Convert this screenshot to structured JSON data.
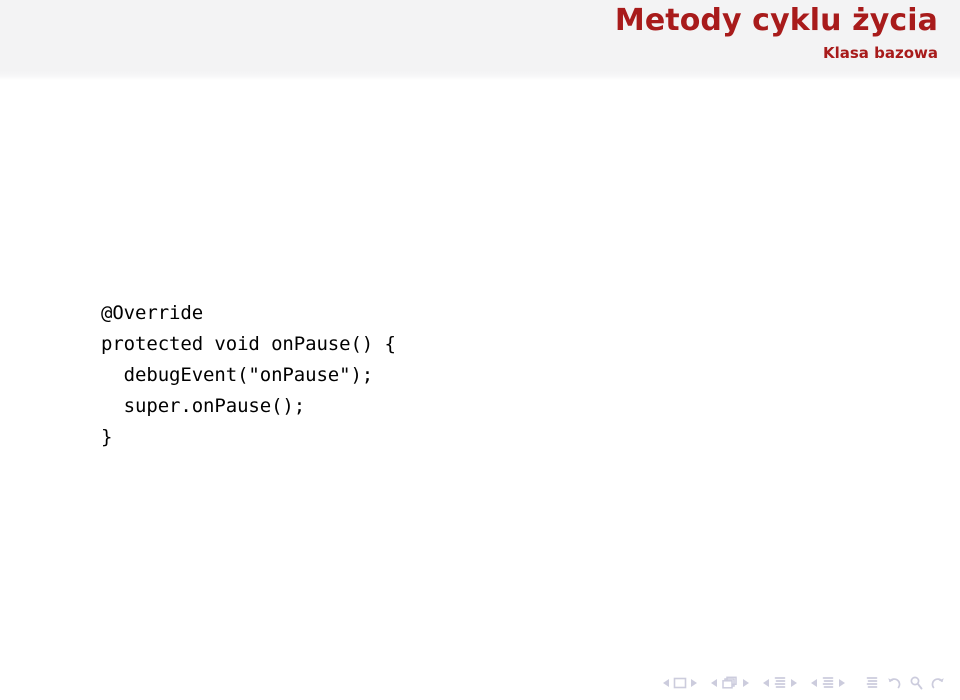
{
  "slide": {
    "title": "Metody cyklu życia",
    "subtitle": "Klasa bazowa",
    "title_color": "#a81b1b",
    "header_bg": "#f3f3f4",
    "body_bg": "#ffffff",
    "code_color": "#000000",
    "nav_color": "#ccccdd"
  },
  "code": {
    "lines": [
      "@Override",
      "protected void onPause() {",
      "  debugEvent(\"onPause\");",
      "  super.onPause();",
      "}"
    ]
  },
  "navigation": {
    "groups": [
      {
        "name": "slide-navigation",
        "icon": "slide-icon",
        "prev_label": "◀",
        "next_label": "▶"
      },
      {
        "name": "frame-navigation",
        "icon": "frames-icon",
        "prev_label": "◀",
        "next_label": "▶"
      },
      {
        "name": "subsection-navigation",
        "icon": "subsection-icon",
        "prev_label": "◀",
        "next_label": "▶"
      },
      {
        "name": "section-navigation",
        "icon": "section-icon",
        "prev_label": "◀",
        "next_label": "▶"
      }
    ],
    "misc": [
      {
        "name": "presentation-icon",
        "label": ""
      },
      {
        "name": "back-icon",
        "label": ""
      },
      {
        "name": "search-icon",
        "label": ""
      },
      {
        "name": "forward-icon",
        "label": ""
      }
    ]
  }
}
